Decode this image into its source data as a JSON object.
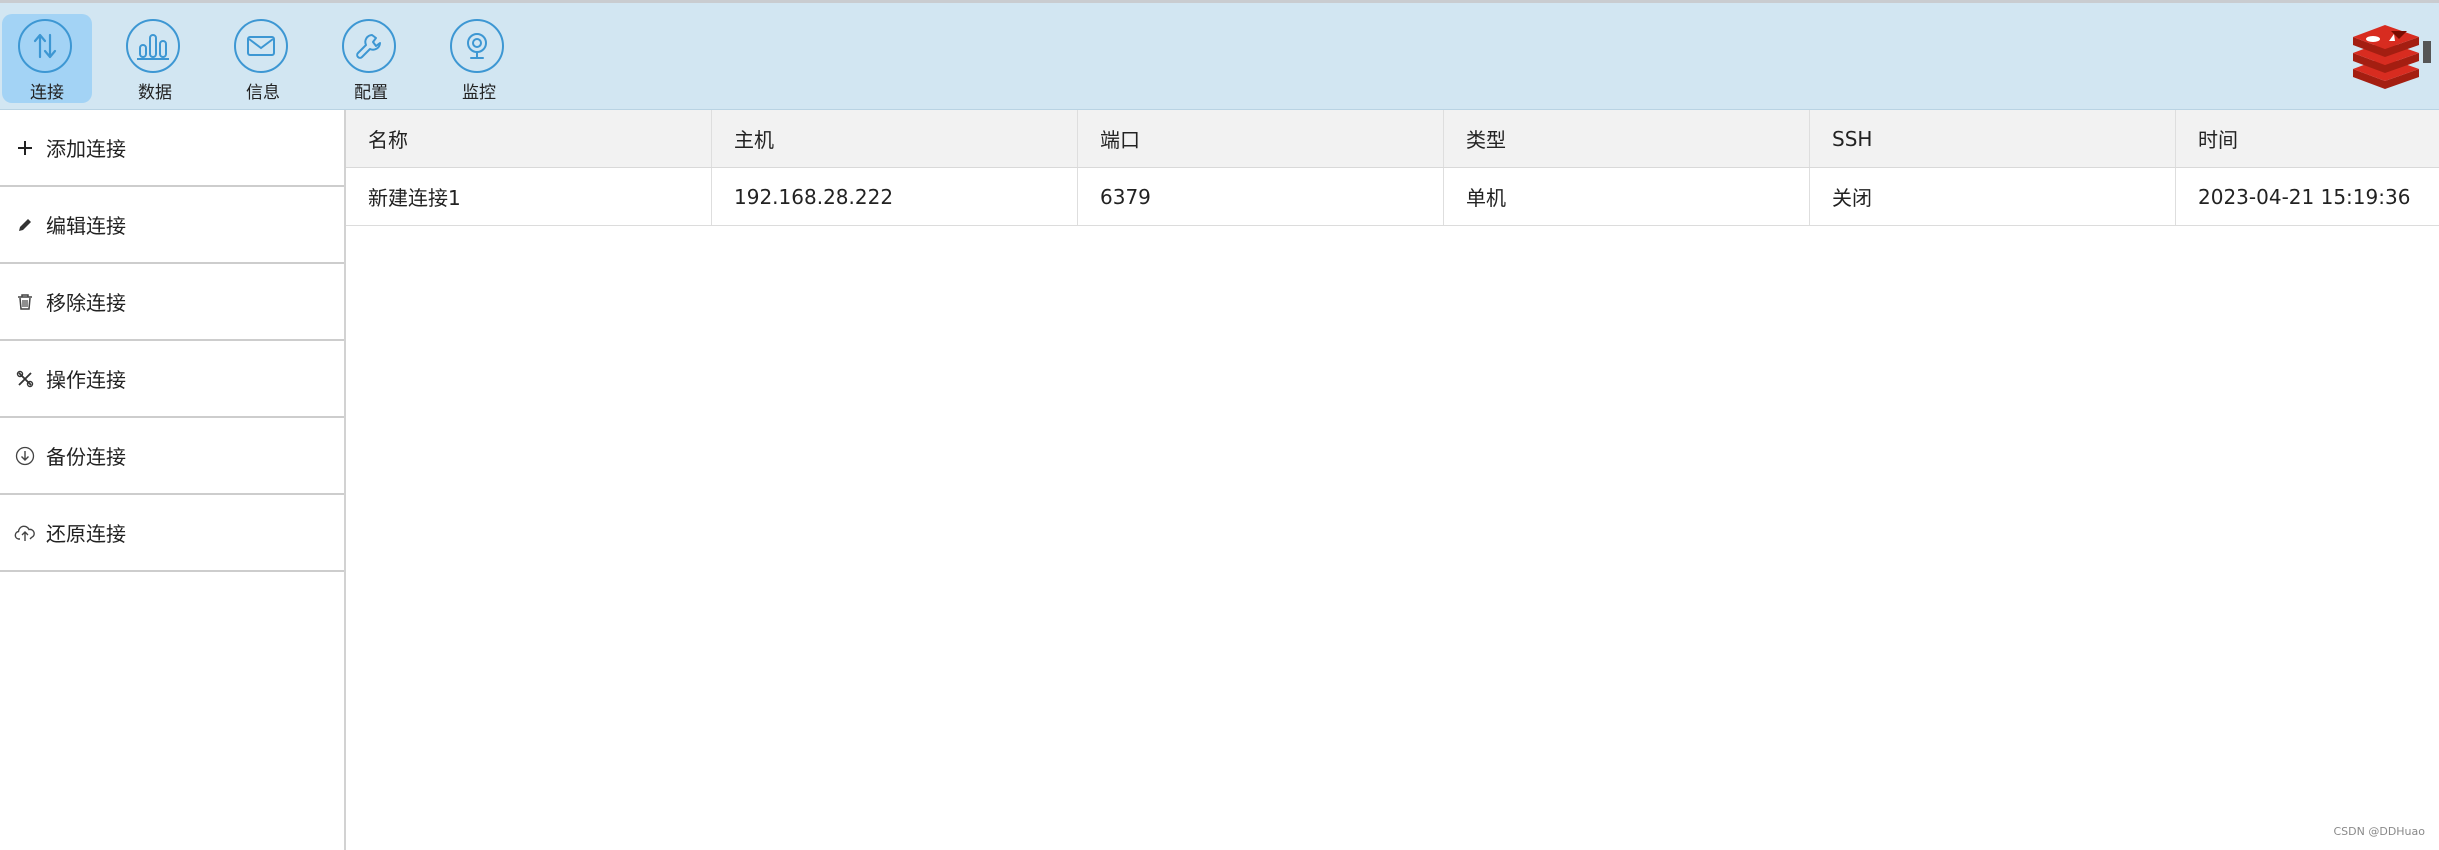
{
  "toolbar": {
    "items": [
      {
        "label": "连接",
        "icon": "swap-vertical-icon",
        "active": true
      },
      {
        "label": "数据",
        "icon": "bar-chart-icon",
        "active": false
      },
      {
        "label": "信息",
        "icon": "mail-icon",
        "active": false
      },
      {
        "label": "配置",
        "icon": "wrench-icon",
        "active": false
      },
      {
        "label": "监控",
        "icon": "webcam-icon",
        "active": false
      }
    ],
    "logo": "redis-logo-icon"
  },
  "sidebar": {
    "items": [
      {
        "label": "添加连接",
        "icon": "plus-icon"
      },
      {
        "label": "编辑连接",
        "icon": "pencil-icon"
      },
      {
        "label": "移除连接",
        "icon": "trash-icon"
      },
      {
        "label": "操作连接",
        "icon": "tools-icon"
      },
      {
        "label": "备份连接",
        "icon": "download-circle-icon"
      },
      {
        "label": "还原连接",
        "icon": "cloud-upload-icon"
      }
    ]
  },
  "table": {
    "columns": [
      "名称",
      "主机",
      "端口",
      "类型",
      "SSH",
      "时间"
    ],
    "rows": [
      [
        "新建连接1",
        "192.168.28.222",
        "6379",
        "单机",
        "关闭",
        "2023-04-21 15:19:36"
      ]
    ]
  },
  "watermark": "CSDN @DDHuao",
  "colors": {
    "toolbar_bg": "#d2e6f2",
    "active_tool_bg": "#a3d3f5",
    "icon_blue": "#3d97d3",
    "header_bg": "#f2f2f2",
    "logo_red": "#d82c20"
  }
}
